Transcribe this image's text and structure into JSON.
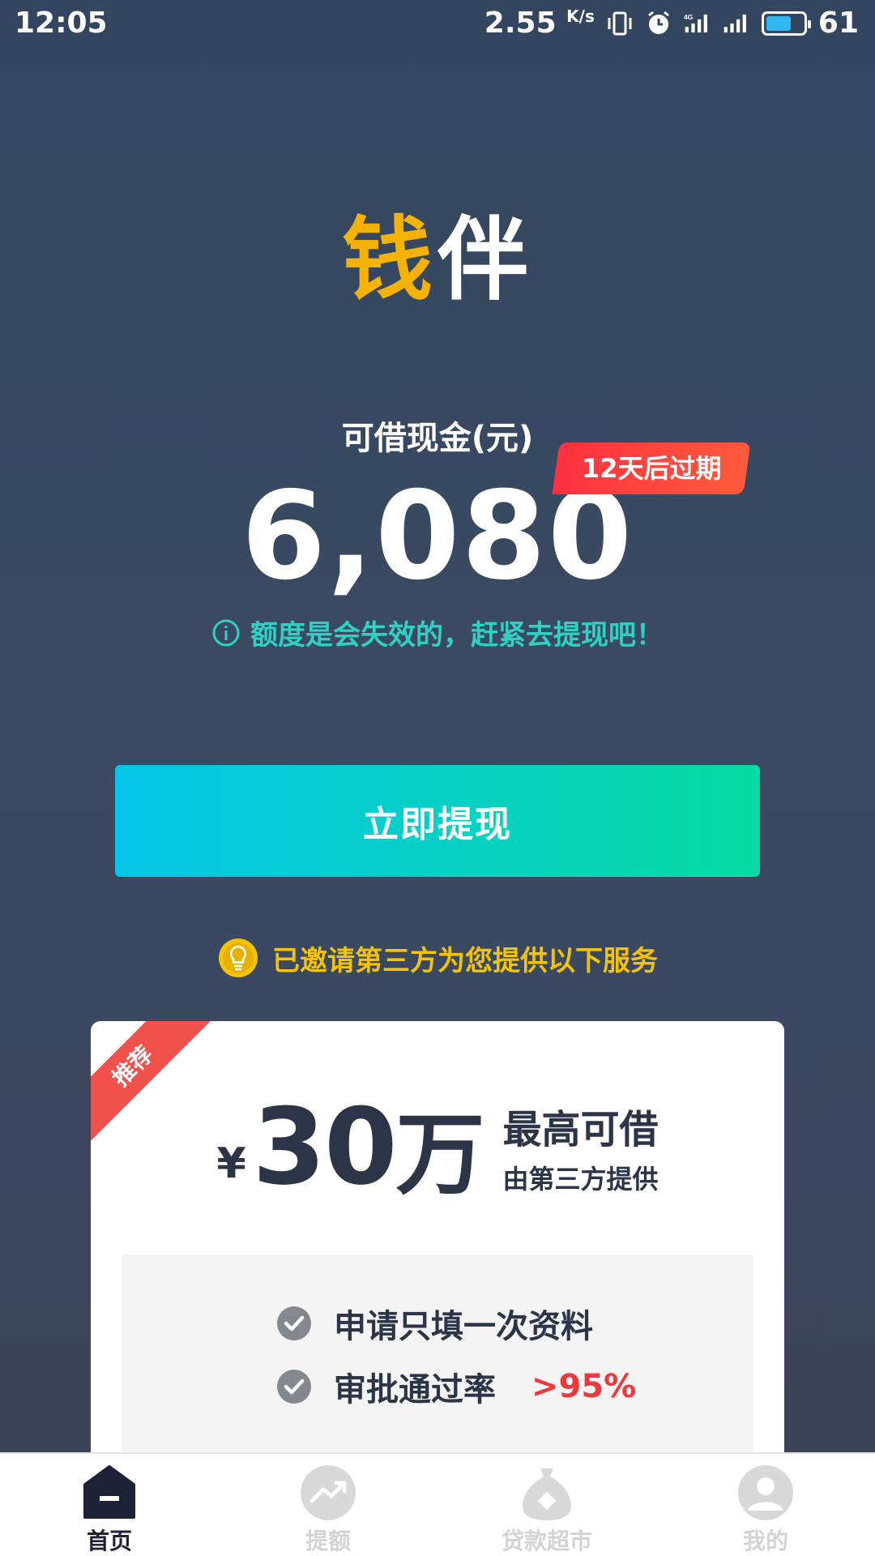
{
  "status_bar": {
    "time": "12:05",
    "speed": "2.55",
    "speed_unit": "K/s",
    "network": "4G",
    "battery": "61"
  },
  "logo": {
    "char1": "钱",
    "char2": "伴"
  },
  "cash": {
    "label": "可借现金(元)",
    "amount": "6,080",
    "expire_badge": "12天后过期",
    "notice": "额度是会失效的，赶紧去提现吧！"
  },
  "withdraw_button": "立即提现",
  "invite_notice": "已邀请第三方为您提供以下服务",
  "offer_card": {
    "ribbon": "推荐",
    "currency": "¥",
    "amount_number": "30",
    "amount_unit": "万",
    "title": "最高可借",
    "subtitle": "由第三方提供",
    "features": [
      {
        "text": "申请只填一次资料",
        "highlight": ""
      },
      {
        "text": "审批通过率",
        "highlight": ">95%"
      }
    ]
  },
  "bottom_nav": [
    {
      "label": "首页",
      "icon": "home-icon",
      "active": true
    },
    {
      "label": "提额",
      "icon": "trend-up-icon",
      "active": false
    },
    {
      "label": "贷款超市",
      "icon": "money-bag-icon",
      "active": false
    },
    {
      "label": "我的",
      "icon": "user-icon",
      "active": false
    }
  ],
  "colors": {
    "background": "#34465f",
    "accent_teal": "#2fd1c3",
    "accent_yellow": "#f4c400",
    "badge_red": "#ff3040",
    "button_start": "#04c6e8",
    "button_end": "#06dba3",
    "nav_active": "#1f2236"
  }
}
